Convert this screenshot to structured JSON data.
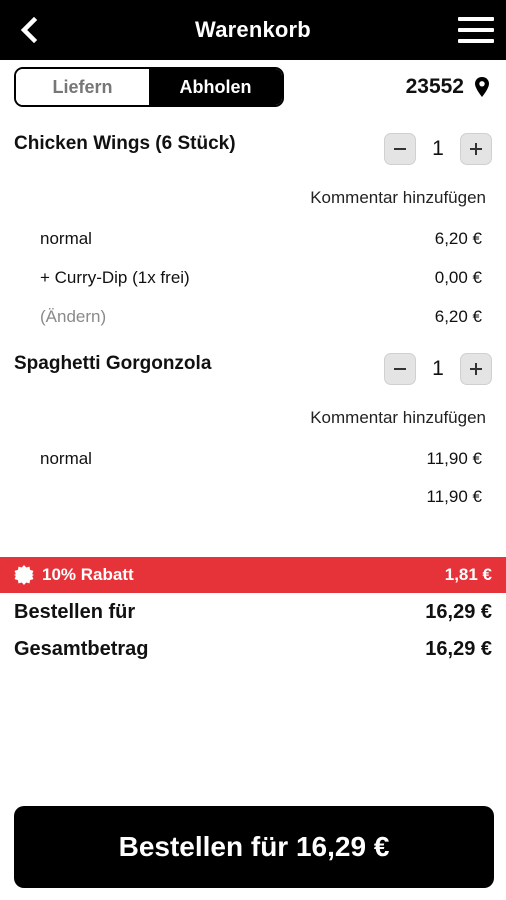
{
  "header": {
    "title": "Warenkorb",
    "back_icon": "chevron-left-icon",
    "menu_icon": "hamburger-menu-icon"
  },
  "delivery_toggle": {
    "options": [
      "Liefern",
      "Abholen"
    ],
    "selected": "Abholen"
  },
  "location": {
    "postal_code": "23552",
    "icon": "location-pin-icon"
  },
  "cart_items": [
    {
      "name": "Chicken Wings (6 Stück)",
      "quantity": "1",
      "comment_label": "Kommentar hinzufügen",
      "lines": [
        {
          "label": "normal",
          "price": "6,20 €"
        },
        {
          "label": "+ Curry-Dip (1x frei)",
          "price": "0,00 €"
        },
        {
          "label": "(Ändern)",
          "price": "6,20 €"
        }
      ]
    },
    {
      "name": "Spaghetti Gorgonzola",
      "quantity": "1",
      "comment_label": "Kommentar hinzufügen",
      "lines": [
        {
          "label": "normal",
          "price": "11,90 €"
        },
        {
          "label": "",
          "price": "11,90 €"
        }
      ]
    }
  ],
  "discount": {
    "label": "10% Rabatt",
    "amount": "1,81 €",
    "icon": "badge-icon",
    "color": "#e6333a"
  },
  "summary": {
    "order_for_label": "Bestellen für",
    "order_for_value": "16,29 €",
    "total_label": "Gesamtbetrag",
    "total_value": "16,29 €"
  },
  "order_button": {
    "label": "Bestellen für 16,29 €"
  }
}
